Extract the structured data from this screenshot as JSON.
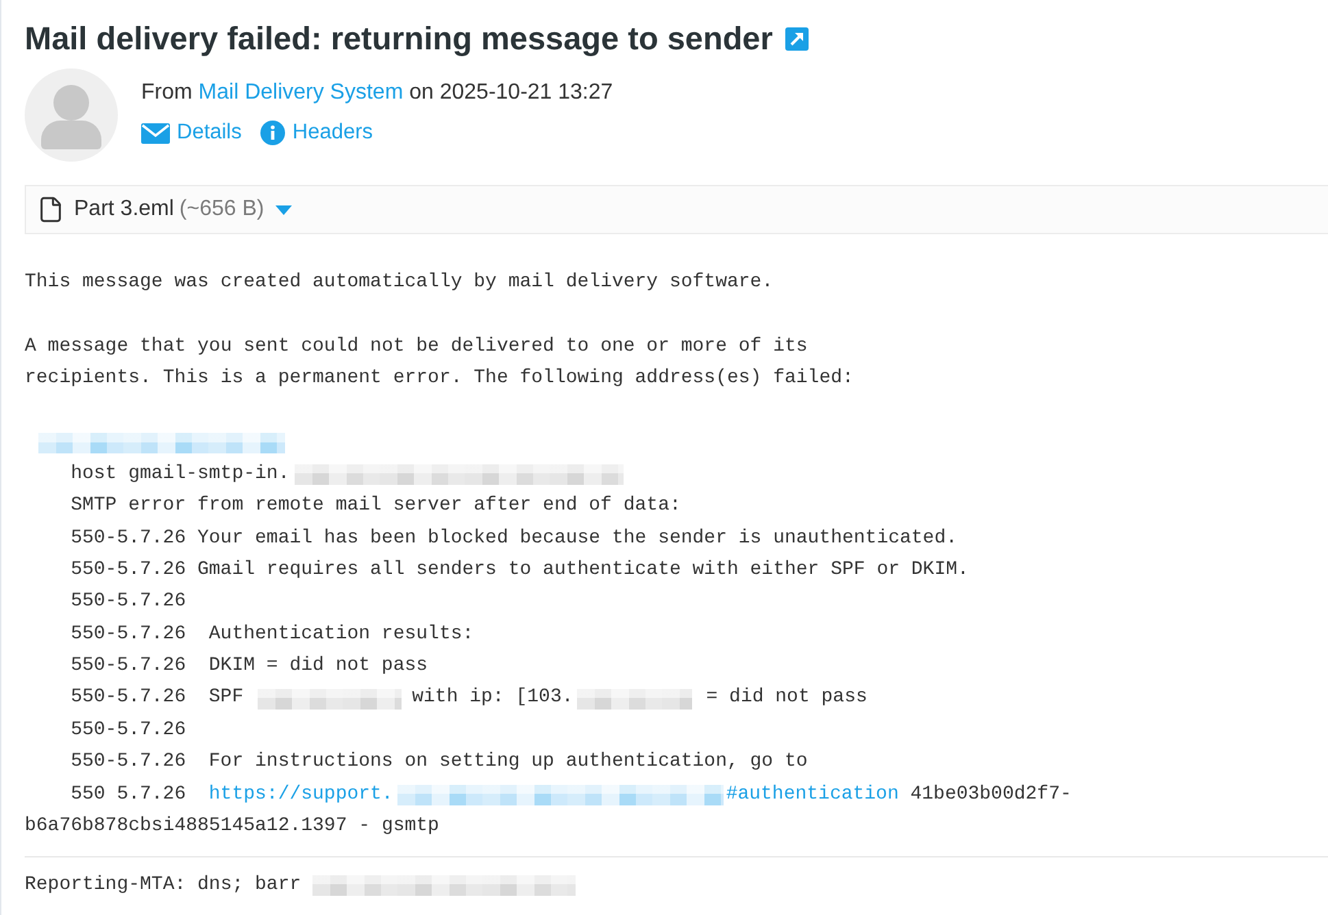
{
  "title": {
    "text": "Mail delivery failed: returning message to sender"
  },
  "sender": {
    "prefix": "From",
    "name": "Mail Delivery System",
    "middle": "on",
    "date": "2025-10-21 13:27"
  },
  "actions": [
    {
      "kind": "details",
      "label": "Details"
    },
    {
      "kind": "headers",
      "label": "Headers"
    }
  ],
  "attachment": {
    "name": "Part 3.eml",
    "size": "(~656 B)"
  },
  "body": {
    "paragraphs": [
      {
        "lines": [
          {
            "indented": false,
            "segments": [
              {
                "kind": "text",
                "text": "This message was created automatically by mail delivery software."
              }
            ]
          }
        ]
      },
      {
        "lines": [
          {
            "indented": false,
            "segments": [
              {
                "kind": "text",
                "text": "A message that you sent could not be delivered to one or more of its"
              }
            ]
          },
          {
            "indented": false,
            "segments": [
              {
                "kind": "text",
                "text": "recipients. This is a permanent error. The following address(es) failed:"
              }
            ]
          }
        ]
      },
      {
        "lines": [
          {
            "indented": false,
            "segments": [
              {
                "kind": "redactedlink"
              }
            ]
          },
          {
            "indented": true,
            "segments": [
              {
                "kind": "text",
                "text": "host gmail-smtp-in."
              },
              {
                "kind": "redacted"
              }
            ]
          },
          {
            "indented": true,
            "segments": [
              {
                "kind": "text",
                "text": "SMTP error from remote mail server after end of data:"
              }
            ]
          },
          {
            "indented": true,
            "segments": [
              {
                "kind": "text",
                "text": "550-5.7.26 Your email has been blocked because the sender is unauthenticated."
              }
            ]
          },
          {
            "indented": true,
            "segments": [
              {
                "kind": "text",
                "text": "550-5.7.26 Gmail requires all senders to authenticate with either SPF or DKIM."
              }
            ]
          },
          {
            "indented": true,
            "segments": [
              {
                "kind": "text",
                "text": "550-5.7.26"
              }
            ]
          },
          {
            "indented": true,
            "segments": [
              {
                "kind": "text",
                "text": "550-5.7.26  Authentication results:"
              }
            ]
          },
          {
            "indented": true,
            "segments": [
              {
                "kind": "text",
                "text": "550-5.7.26  DKIM = did not pass"
              }
            ]
          },
          {
            "indented": true,
            "segments": [
              {
                "kind": "text",
                "text": "550-5.7.26  SPF"
              },
              {
                "kind": "redacted"
              },
              {
                "kind": "text",
                "text": "with ip: [103."
              },
              {
                "kind": "redacted"
              },
              {
                "kind": "text",
                "text": "= did not pass"
              }
            ]
          },
          {
            "indented": true,
            "segments": [
              {
                "kind": "text",
                "text": "550-5.7.26"
              }
            ]
          },
          {
            "indented": true,
            "segments": [
              {
                "kind": "text",
                "text": "550-5.7.26  For instructions on setting up authentication, go to"
              }
            ]
          },
          {
            "indented": true,
            "segments": [
              {
                "kind": "text",
                "text": "550 5.7.26"
              },
              {
                "kind": "link",
                "text": "https://support."
              },
              {
                "kind": "redactedlink"
              },
              {
                "kind": "link",
                "text": "#authentication"
              },
              {
                "kind": "text",
                "text": "41be03b00d2f7-"
              }
            ]
          },
          {
            "indented": false,
            "segments": [
              {
                "kind": "text",
                "text": "b6a76b878cbsi4885145a12.1397 - gsmtp"
              }
            ]
          }
        ]
      }
    ]
  },
  "footer": {
    "lines": [
      {
        "indented": false,
        "segments": [
          {
            "kind": "text",
            "text": "Reporting-MTA: dns; barr"
          },
          {
            "kind": "redacted"
          }
        ]
      }
    ]
  }
}
